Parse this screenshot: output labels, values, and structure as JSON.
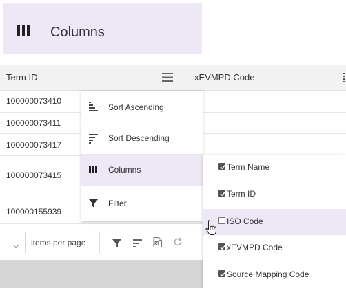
{
  "header": {
    "icon": "columns-icon",
    "title": "Columns"
  },
  "grid": {
    "columns": [
      {
        "label": "Term ID"
      },
      {
        "label": "xEVMPD Code"
      }
    ],
    "column_menu_icon": "hamburger-menu-icon",
    "rows": [
      {
        "term_id": "100000073410"
      },
      {
        "term_id": "100000073411"
      },
      {
        "term_id": "100000073417"
      },
      {
        "term_id": "100000073415"
      },
      {
        "term_id": "100000155939"
      }
    ]
  },
  "pager": {
    "items_per_page_label": "items per page",
    "tools": [
      "filter-icon",
      "sort-icon",
      "excel-export-icon",
      "refresh-icon"
    ]
  },
  "column_menu": {
    "items": [
      {
        "label": "Sort Ascending",
        "icon": "sort-ascending-icon"
      },
      {
        "label": "Sort Descending",
        "icon": "sort-descending-icon"
      },
      {
        "label": "Columns",
        "icon": "columns-icon",
        "active": true
      },
      {
        "label": "Filter",
        "icon": "filter-icon"
      }
    ]
  },
  "columns_submenu": {
    "items": [
      {
        "label": "Term Name",
        "checked": true
      },
      {
        "label": "Term ID",
        "checked": true
      },
      {
        "label": "ISO Code",
        "checked": false,
        "hovered": true
      },
      {
        "label": "xEVMPD Code",
        "checked": true
      },
      {
        "label": "Source Mapping Code",
        "checked": true
      }
    ]
  },
  "colors": {
    "accent_light": "#ede7f6",
    "header_bg": "#f2f2f2",
    "text": "#333333"
  }
}
